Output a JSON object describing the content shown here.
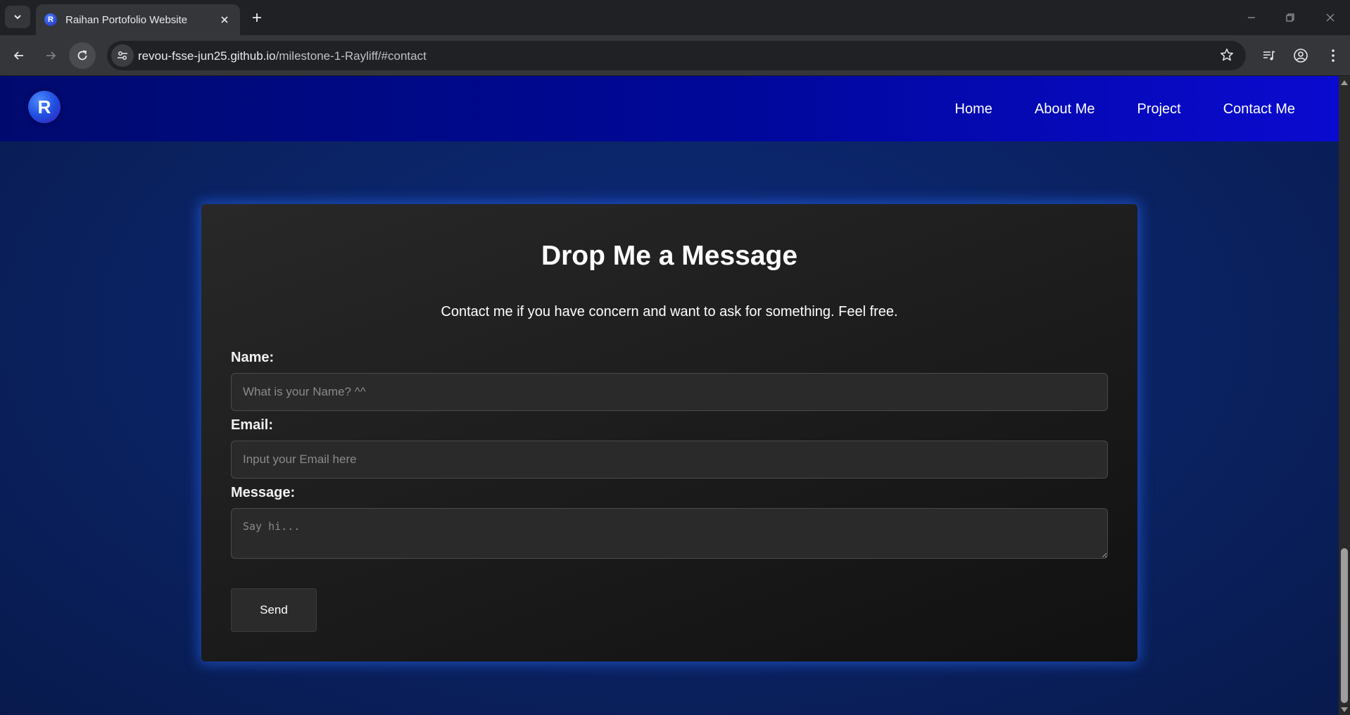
{
  "browser": {
    "tab_title": "Raihan Portofolio Website",
    "tab_favicon_letter": "R",
    "url_host": "revou-fsse-jun25.github.io",
    "url_path": "/milestone-1-Rayliff/#contact",
    "icons": {
      "tab_search": "chevron-down-icon",
      "tab_close": "close-icon",
      "new_tab": "plus-icon",
      "back": "arrow-left-icon",
      "forward": "arrow-right-icon",
      "reload": "reload-icon",
      "site_info": "tune-icon",
      "bookmark": "star-icon",
      "media": "media-queue-icon",
      "profile": "account-icon",
      "menu": "kebab-menu-icon"
    }
  },
  "site": {
    "logo_letter": "R",
    "nav": [
      "Home",
      "About Me",
      "Project",
      "Contact Me"
    ]
  },
  "contact": {
    "heading": "Drop Me a Message",
    "subtitle": "Contact me if you have concern and want to ask for something. Feel free.",
    "name_label": "Name:",
    "name_placeholder": "What is your Name? ^^",
    "email_label": "Email:",
    "email_placeholder": "Input your Email here",
    "message_label": "Message:",
    "message_placeholder": "Say hi...",
    "send_label": "Send"
  },
  "colors": {
    "navbar_start": "#000a6e",
    "navbar_end": "#0a0ad0",
    "card_glow": "#286eff",
    "page_bg": "#0b2466"
  }
}
